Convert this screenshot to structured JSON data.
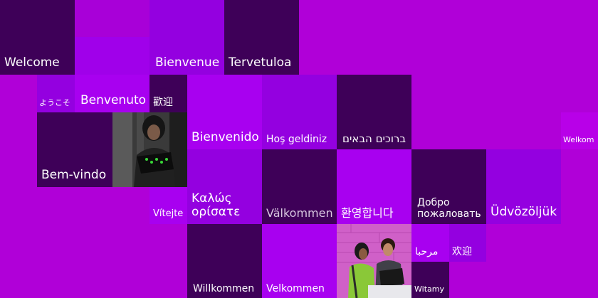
{
  "colors": {
    "background": "#b000d8",
    "dark": "#3e0058",
    "medium": "#8c00d0",
    "bright": "#a800f0",
    "magenta": "#b800e8"
  },
  "tiles": {
    "welcome": "Welcome",
    "bienvenue": "Bienvenue",
    "tervetuloa": "Tervetuloa",
    "youkoso": "ようこそ",
    "benvenuto": "Benvenuto",
    "huanying_tw": "歡迎",
    "bienvenido": "Bienvenido",
    "hos_geldiniz": "Hoş geldiniz",
    "hebrew": "ברוכים הבאים",
    "welkom": "Welkom",
    "bem_vindo": "Bem-vindo",
    "kalos": "Καλώς ορίσατε",
    "vitejte": "Vítejte",
    "valkommen": "Välkommen",
    "korean": "환영합니다",
    "dobro": "Добро пожаловать",
    "udvozoljuk": "Üdvözöljük",
    "marhaba": "مرحبا",
    "huanying_cn": "欢迎",
    "willkommen": "Willkommen",
    "velkommen": "Velkommen",
    "witamy": "Witamy"
  }
}
